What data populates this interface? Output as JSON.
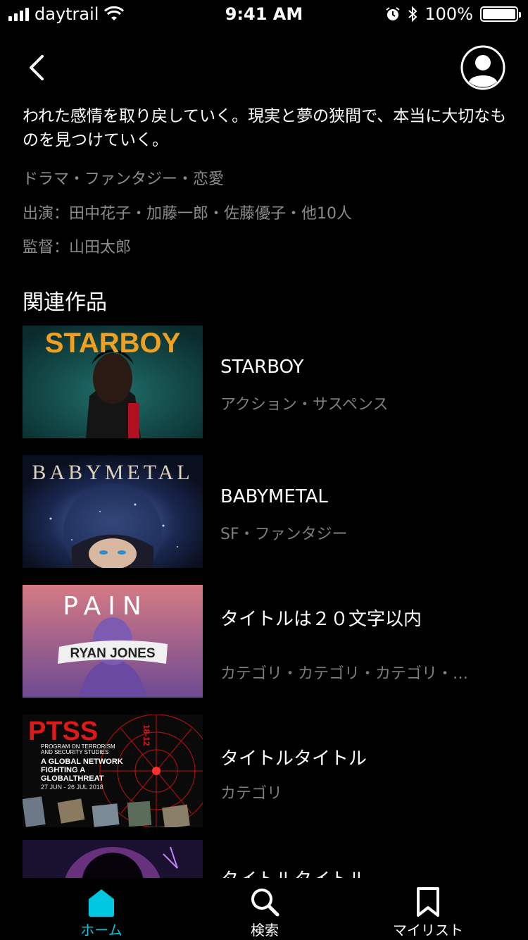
{
  "status_bar": {
    "carrier": "daytrail",
    "time": "9:41 AM",
    "battery": "100%"
  },
  "description": {
    "text": "われた感情を取り戻していく。現実と夢の狭間で、本当に大切なものを見つけていく。",
    "genres": "ドラマ・ファンタジー・恋愛",
    "cast": "出演：田中花子・加藤一郎・佐藤優子・他10人",
    "director": "監督：山田太郎"
  },
  "related": {
    "title": "関連作品",
    "items": [
      {
        "title": "STARBOY",
        "category": "アクション・サスペンス",
        "poster_text": "STARBOY"
      },
      {
        "title": "BABYMETAL",
        "category": "SF・ファンタジー",
        "poster_text": "BABYMETAL"
      },
      {
        "title": "タイトルは２０文字以内",
        "category": "カテゴリ・カテゴリ・カテゴリ・…",
        "poster_text": "PAIN",
        "poster_sub": "RYAN JONES"
      },
      {
        "title": "タイトルタイトル",
        "category": "カテゴリ",
        "poster_text": "PTSS",
        "poster_year": "18-12",
        "poster_lines": [
          "PROGRAM ON TERRORISM",
          "AND SECURITY STUDIES",
          "A GLOBAL NETWORK",
          "FIGHTING A",
          "GLOBALTHREAT",
          "27 JUN - 26 JUL 2018"
        ]
      },
      {
        "title": "タイトルタイトル",
        "category": ""
      }
    ]
  },
  "tabs": [
    {
      "label": "ホーム",
      "icon": "home-icon",
      "active": true
    },
    {
      "label": "検索",
      "icon": "search-icon",
      "active": false
    },
    {
      "label": "マイリスト",
      "icon": "bookmark-icon",
      "active": false
    }
  ],
  "colors": {
    "accent": "#00c8e0",
    "background": "#000000",
    "secondary_text": "#8b8b8b"
  }
}
